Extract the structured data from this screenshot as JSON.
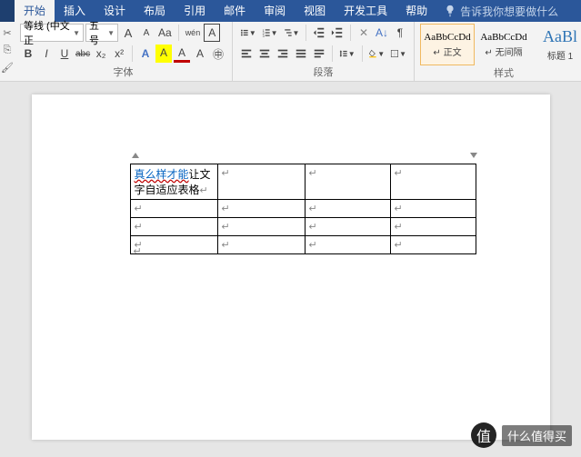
{
  "tabs": {
    "start": "开始",
    "insert": "插入",
    "design": "设计",
    "layout": "布局",
    "references": "引用",
    "mailings": "邮件",
    "review": "审阅",
    "view": "视图",
    "developer": "开发工具",
    "help": "帮助",
    "tell_me": "告诉我你想要做什么"
  },
  "font": {
    "name": "等线 (中文正",
    "size": "五号",
    "grow": "A",
    "shrink": "A",
    "case": "Aa",
    "clear": "A",
    "pinyin": "wén",
    "charborder": "A",
    "bold": "B",
    "italic": "I",
    "underline": "U",
    "strike": "abc",
    "sub": "x₂",
    "sup": "x²",
    "effects": "A",
    "highlight": "A",
    "color": "A",
    "enclose": "㊥",
    "group_label": "字体"
  },
  "para": {
    "group_label": "段落"
  },
  "styles": {
    "normal_preview": "AaBbCcDd",
    "normal_name": "↵ 正文",
    "nospace_preview": "AaBbCcDd",
    "nospace_name": "↵ 无间隔",
    "h1_preview": "AaBl",
    "h1_name": "标题 1",
    "group_label": "样式"
  },
  "table": {
    "cell_link": "真么样才能",
    "cell_rest": "让文字自适应表格",
    "mark": "↵"
  },
  "watermark": {
    "icon": "值",
    "text": "什么值得买"
  }
}
